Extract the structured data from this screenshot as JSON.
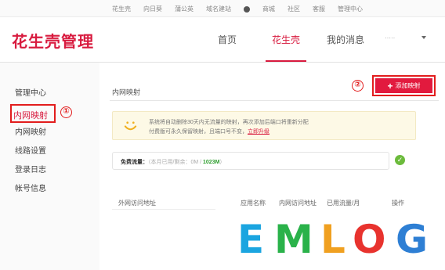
{
  "topbar": {
    "links": [
      "花生壳",
      "向日葵",
      "蒲公英",
      "域名建站",
      "商城",
      "社区",
      "客服",
      "管理中心"
    ]
  },
  "header": {
    "logo": "花生壳管理",
    "nav": [
      "首页",
      "花生壳",
      "我的消息"
    ],
    "active_nav": "花生壳",
    "user": "·····"
  },
  "sidebar": {
    "heading": "管理中心",
    "highlighted": "内网映射",
    "items": [
      "内网映射",
      "线路设置",
      "登录日志",
      "帐号信息"
    ]
  },
  "annotations": [
    "①",
    "②"
  ],
  "main": {
    "title": "内网映射",
    "add_button": "添加映射",
    "notice": {
      "line1": "系统将自动删除30天内无流量的映射，再次添加后端口将重新分配",
      "line2": "付费版可永久保留映射，且端口号不变，",
      "link": "立即升级"
    },
    "traffic": {
      "label": "免费流量：",
      "detail": "（本月已用/剩余：0M / ",
      "total": "1023M",
      "close": "）"
    },
    "table_headers": [
      "外网访问地址",
      "应用名称",
      "内网访问地址",
      "已用流量/月",
      "操作"
    ]
  },
  "watermark": {
    "letters": [
      "E",
      "M",
      "L",
      "O",
      "G"
    ],
    "colors": [
      "#1ba5e0",
      "#2ab24a",
      "#f0a020",
      "#e8332e",
      "#2e7fd4"
    ]
  },
  "colors": {
    "brand": "#d81b3f",
    "highlight_box": "#e21d1d",
    "notice_bg": "#fdf9e6",
    "success": "#6cbb3c"
  }
}
